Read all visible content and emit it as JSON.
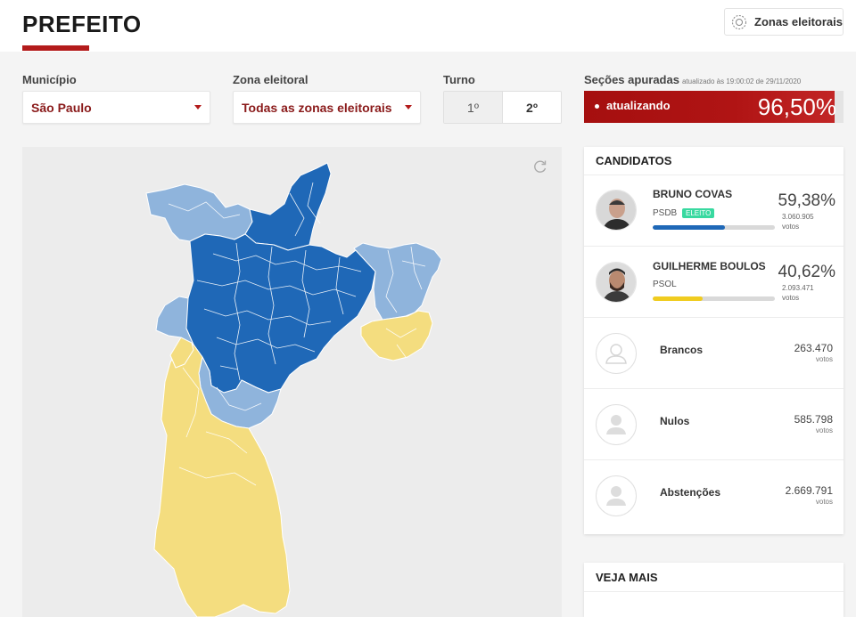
{
  "header": {
    "title": "PREFEITO",
    "zonas_button": "Zonas eleitorais",
    "accent_color": "#b31b1b"
  },
  "filters": {
    "municipio": {
      "label": "Município",
      "value": "São Paulo"
    },
    "zona": {
      "label": "Zona eleitoral",
      "value": "Todas as zonas eleitorais"
    },
    "turno": {
      "label": "Turno",
      "options": [
        "1º",
        "2º"
      ],
      "selected": "2º"
    }
  },
  "secoes": {
    "label": "Seções apuradas",
    "updated": "atualizado às 19:00:02 de 29/11/2020",
    "status": "atualizando",
    "percent_label": "96,50%",
    "percent_value": 0.965
  },
  "map": {
    "colors": {
      "covas_strong": "#1f68b7",
      "covas_light": "#8fb4dc",
      "boulos": "#f4dd7f",
      "background": "#ececec"
    }
  },
  "candidatos": {
    "heading": "CANDIDATOS",
    "list": [
      {
        "name": "BRUNO COVAS",
        "party": "PSDB",
        "badge": "ELEITO",
        "percent": "59,38%",
        "share": 0.5938,
        "votes": "3.060.905",
        "unit": "votos",
        "color": "#1f68b7"
      },
      {
        "name": "GUILHERME BOULOS",
        "party": "PSOL",
        "badge": "",
        "percent": "40,62%",
        "share": 0.4062,
        "votes": "2.093.471",
        "unit": "votos",
        "color": "#f0cc1f"
      }
    ],
    "others": [
      {
        "name": "Brancos",
        "count": "263.470",
        "unit": "votos"
      },
      {
        "name": "Nulos",
        "count": "585.798",
        "unit": "votos"
      },
      {
        "name": "Abstenções",
        "count": "2.669.791",
        "unit": "votos"
      }
    ]
  },
  "veja_mais": {
    "heading": "VEJA MAIS"
  },
  "icons": [
    "target-icon",
    "caret-down-icon",
    "reset-icon",
    "user-placeholder-icon"
  ]
}
